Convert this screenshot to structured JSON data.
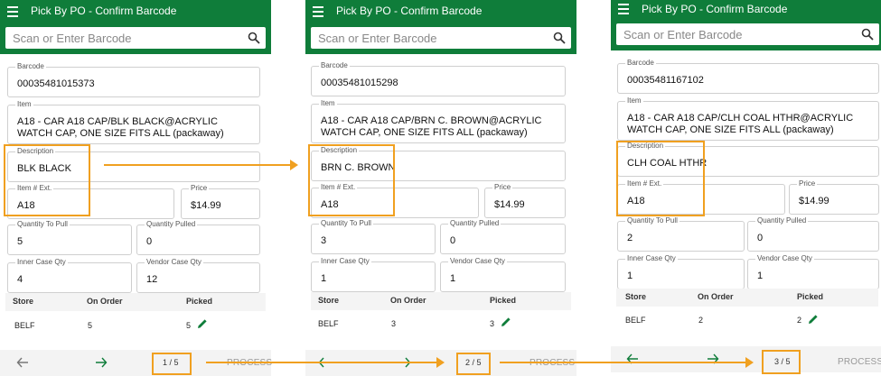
{
  "app": {
    "title": "Pick By PO - Confirm Barcode",
    "search_placeholder": "Scan or Enter Barcode",
    "brand_color": "#0f7d3a",
    "highlight_color": "#f0a020",
    "edit_icon_color": "#0f7d3a"
  },
  "labels": {
    "barcode": "Barcode",
    "item": "Item",
    "description": "Description",
    "item_ext": "Item # Ext.",
    "price": "Price",
    "qty_to_pull": "Quantity To Pull",
    "qty_pulled": "Quantity Pulled",
    "inner_case_qty": "Inner Case Qty",
    "vendor_case_qty": "Vendor Case Qty"
  },
  "table": {
    "headers": [
      "Store",
      "On Order",
      "Picked"
    ]
  },
  "panels": [
    {
      "barcode": "00035481015373",
      "item": "A18 - CAR A18 CAP/BLK BLACK@ACRYLIC WATCH CAP, ONE SIZE FITS ALL (packaway)",
      "description": "BLK BLACK",
      "item_ext": "A18",
      "price": "$14.99",
      "qty_to_pull": "5",
      "qty_pulled": "0",
      "inner_case_qty": "4",
      "vendor_case_qty": "12",
      "row": {
        "store": "BELF",
        "on_order": "5",
        "picked": "5"
      },
      "pager": "1 / 5",
      "process": "PROCESS"
    },
    {
      "barcode": "00035481015298",
      "item": "A18 - CAR A18 CAP/BRN C. BROWN@ACRYLIC WATCH CAP, ONE SIZE FITS ALL (packaway)",
      "description": "BRN C. BROWN",
      "item_ext": "A18",
      "price": "$14.99",
      "qty_to_pull": "3",
      "qty_pulled": "0",
      "inner_case_qty": "1",
      "vendor_case_qty": "1",
      "row": {
        "store": "BELF",
        "on_order": "3",
        "picked": "3"
      },
      "pager": "2 / 5",
      "process": "PROCESS"
    },
    {
      "barcode": "00035481167102",
      "item": "A18 - CAR A18 CAP/CLH COAL HTHR@ACRYLIC WATCH CAP, ONE SIZE FITS ALL (packaway)",
      "description": "CLH COAL HTHR",
      "item_ext": "A18",
      "price": "$14.99",
      "qty_to_pull": "2",
      "qty_pulled": "0",
      "inner_case_qty": "1",
      "vendor_case_qty": "1",
      "row": {
        "store": "BELF",
        "on_order": "2",
        "picked": "2"
      },
      "pager": "3 / 5",
      "process": "PROCESS"
    }
  ]
}
